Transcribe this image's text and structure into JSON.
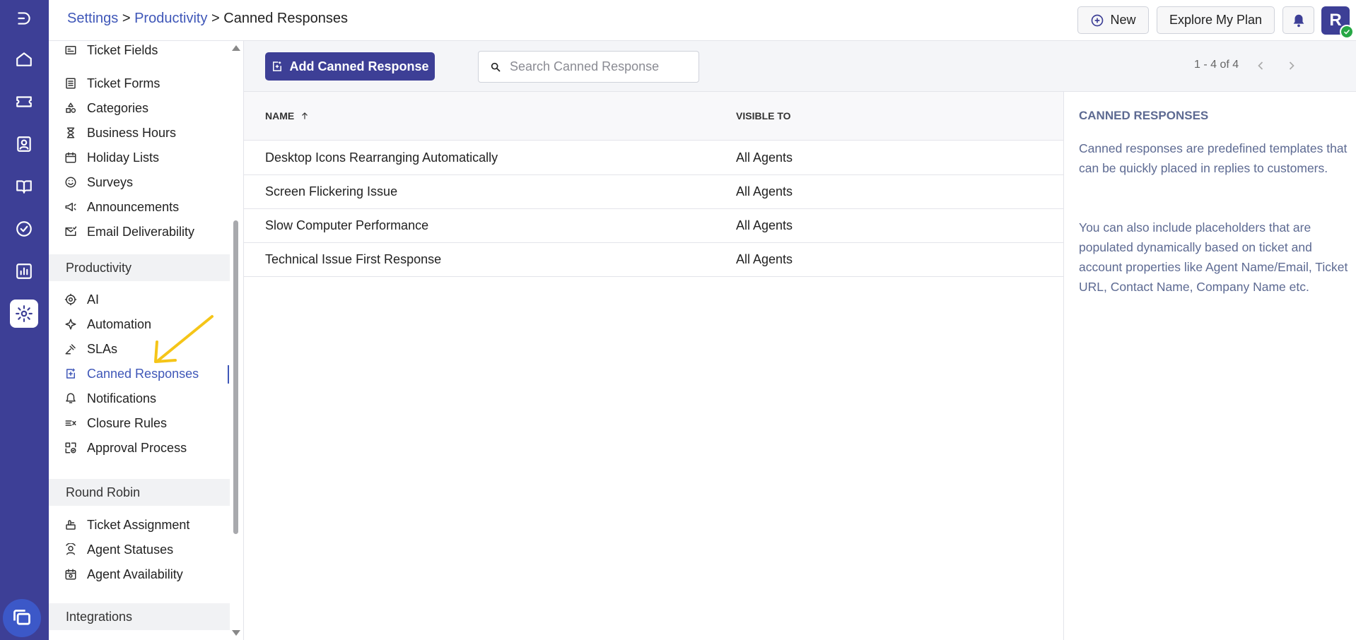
{
  "breadcrumb": {
    "settings": "Settings",
    "sep1": ">",
    "productivity": "Productivity",
    "sep2": ">",
    "current": "Canned Responses"
  },
  "header": {
    "new_label": "New",
    "plan_label": "Explore My Plan",
    "avatar_initial": "R"
  },
  "sidebar": {
    "items_top": [
      {
        "label": "Ticket Fields",
        "icon": "ticket-fields-icon"
      },
      {
        "label": "Ticket Forms",
        "icon": "ticket-forms-icon"
      },
      {
        "label": "Categories",
        "icon": "categories-icon"
      },
      {
        "label": "Business Hours",
        "icon": "hourglass-icon"
      },
      {
        "label": "Holiday Lists",
        "icon": "calendar-icon"
      },
      {
        "label": "Surveys",
        "icon": "smiley-icon"
      },
      {
        "label": "Announcements",
        "icon": "megaphone-icon"
      },
      {
        "label": "Email Deliverability",
        "icon": "mail-check-icon"
      }
    ],
    "productivity_header": "Productivity",
    "productivity_items": [
      {
        "label": "AI",
        "icon": "ai-icon"
      },
      {
        "label": "Automation",
        "icon": "sparkle-icon"
      },
      {
        "label": "SLAs",
        "icon": "gavel-icon"
      },
      {
        "label": "Canned Responses",
        "icon": "canned-response-icon"
      },
      {
        "label": "Notifications",
        "icon": "bell-icon"
      },
      {
        "label": "Closure Rules",
        "icon": "closure-icon"
      },
      {
        "label": "Approval Process",
        "icon": "approval-icon"
      }
    ],
    "roundrobin_header": "Round Robin",
    "roundrobin_items": [
      {
        "label": "Ticket Assignment",
        "icon": "assign-icon"
      },
      {
        "label": "Agent Statuses",
        "icon": "agent-status-icon"
      },
      {
        "label": "Agent Availability",
        "icon": "availability-icon"
      }
    ],
    "integrations_header": "Integrations"
  },
  "toolbar": {
    "add_label": "Add Canned Response",
    "search_placeholder": "Search Canned Response",
    "pager": "1 - 4 of 4"
  },
  "table": {
    "col_name": "NAME",
    "col_visible": "VISIBLE TO",
    "rows": [
      {
        "name": "Desktop Icons Rearranging Automatically",
        "visible": "All Agents"
      },
      {
        "name": "Screen Flickering Issue",
        "visible": "All Agents"
      },
      {
        "name": "Slow Computer Performance",
        "visible": "All Agents"
      },
      {
        "name": "Technical Issue First Response",
        "visible": "All Agents"
      }
    ]
  },
  "info_panel": {
    "title": "CANNED RESPONSES",
    "para1": "Canned responses are predefined templates that can be quickly placed in replies to customers.",
    "para2": "You can also include placeholders that are populated dynamically based on ticket and account properties like Agent Name/Email, Ticket URL, Contact Name, Company Name etc."
  },
  "colors": {
    "brand": "#3d3f96",
    "link": "#3f57b8",
    "annotation": "#f5c518"
  }
}
